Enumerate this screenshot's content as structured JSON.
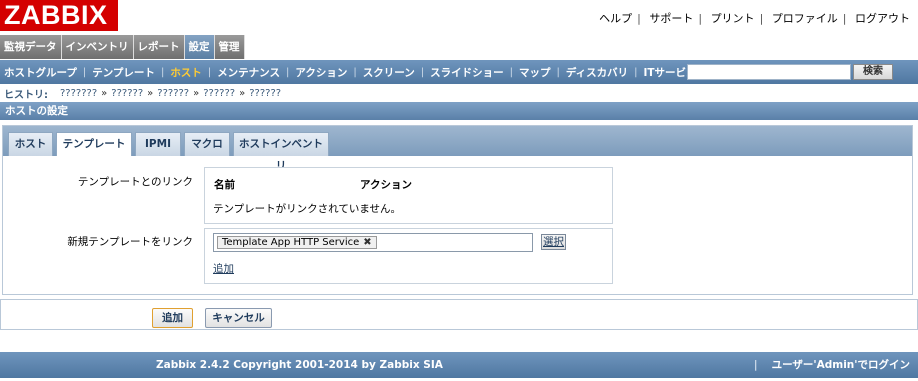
{
  "logo": "ZABBIX",
  "top_links": [
    "ヘルプ",
    "サポート",
    "プリント",
    "プロファイル",
    "ログアウト"
  ],
  "main_menu": [
    "監視データ",
    "インベントリ",
    "レポート",
    "設定",
    "管理"
  ],
  "sub_menu": [
    "ホストグループ",
    "テンプレート",
    "ホスト",
    "メンテナンス",
    "アクション",
    "スクリーン",
    "スライドショー",
    "マップ",
    "ディスカバリ",
    "ITサービス"
  ],
  "search": {
    "button": "検索"
  },
  "history": {
    "label": "ヒストリ:",
    "items": [
      "???????",
      "??????",
      "??????",
      "??????",
      "??????"
    ]
  },
  "section_title": "ホストの設定",
  "tabs": [
    "ホスト",
    "テンプレート",
    "IPMI",
    "マクロ",
    "ホストインベントリ"
  ],
  "linked": {
    "label": "テンプレートとのリンク",
    "col_name": "名前",
    "col_action": "アクション",
    "empty": "テンプレートがリンクされていません。"
  },
  "new_link": {
    "label": "新規テンプレートをリンク",
    "chip": "Template App HTTP Service",
    "select": "選択",
    "add": "追加"
  },
  "buttons": {
    "add": "追加",
    "cancel": "キャンセル"
  },
  "footer": {
    "copyright": "Zabbix 2.4.2 Copyright 2001-2014 by Zabbix SIA",
    "user": "ユーザー'Admin'でログイン"
  }
}
